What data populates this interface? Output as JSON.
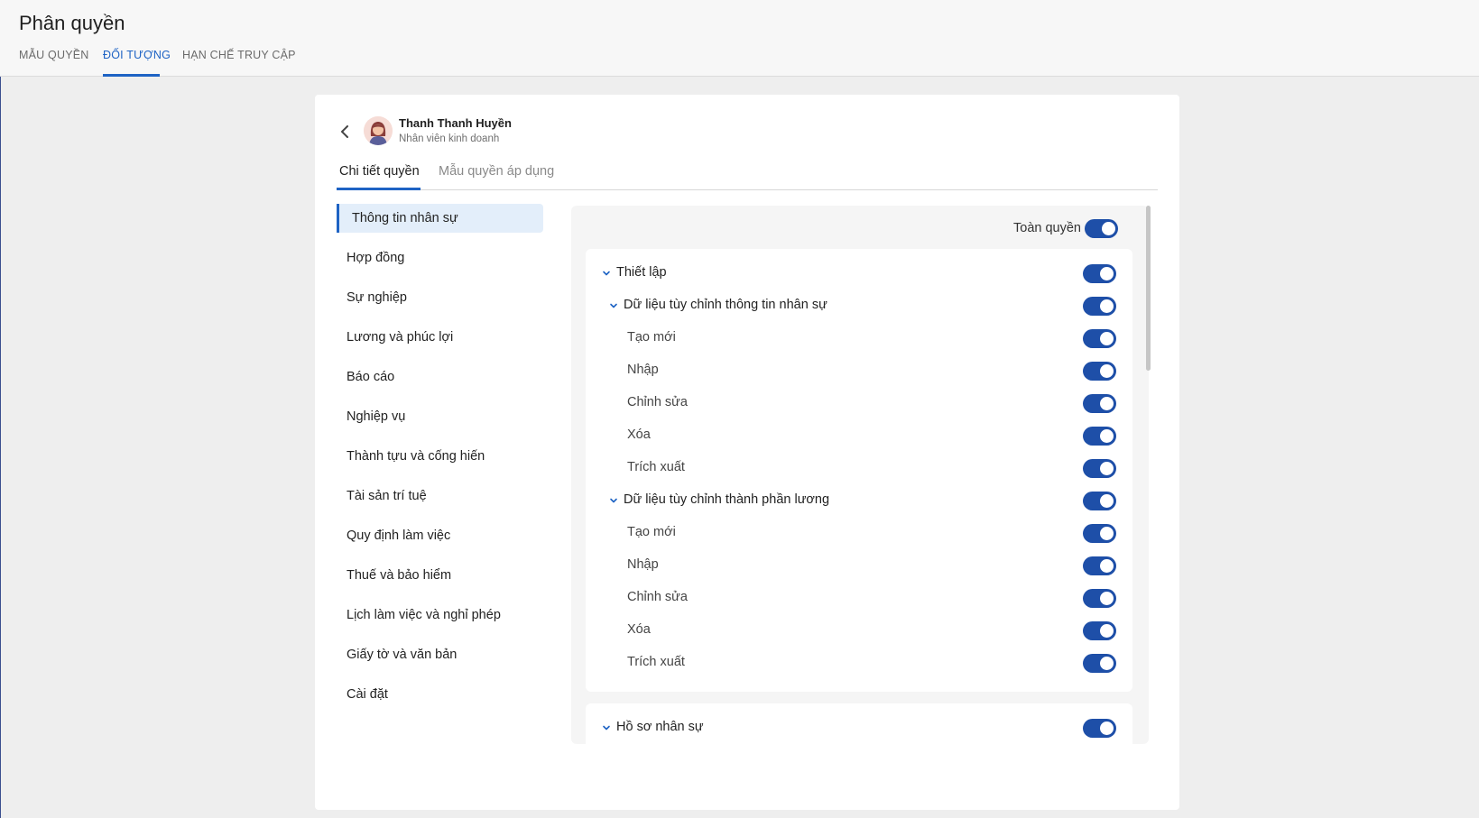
{
  "page": {
    "title": "Phân quyền",
    "tabs": [
      {
        "label": "MẪU QUYỀN"
      },
      {
        "label": "ĐỐI TƯỢNG"
      },
      {
        "label": "HẠN CHẾ TRUY CẬP"
      }
    ],
    "active_tab": "ĐỐI TƯỢNG"
  },
  "user": {
    "name": "Thanh Thanh Huyền",
    "role": "Nhân viên kinh doanh"
  },
  "detail_tabs": [
    {
      "label": "Chi tiết quyền"
    },
    {
      "label": "Mẫu quyền áp dụng"
    }
  ],
  "active_detail_tab": "Chi tiết quyền",
  "categories": [
    {
      "label": "Thông tin nhân sự"
    },
    {
      "label": "Hợp đồng"
    },
    {
      "label": "Sự nghiệp"
    },
    {
      "label": "Lương và phúc lợi"
    },
    {
      "label": "Báo cáo"
    },
    {
      "label": "Nghiệp vụ"
    },
    {
      "label": "Thành tựu và cống hiến"
    },
    {
      "label": "Tài sản trí tuệ"
    },
    {
      "label": "Quy định làm việc"
    },
    {
      "label": "Thuế và bảo hiểm"
    },
    {
      "label": "Lịch làm việc và nghỉ phép"
    },
    {
      "label": "Giấy tờ và văn bản"
    },
    {
      "label": "Cài đặt"
    }
  ],
  "active_category": "Thông tin nhân sự",
  "permissions": {
    "full_access_label": "Toàn quyền",
    "full_access_on": true,
    "setup": {
      "label": "Thiết lập",
      "on": true,
      "groups": [
        {
          "label": "Dữ liệu tùy chỉnh thông tin nhân sự",
          "on": true,
          "items": [
            {
              "label": "Tạo mới",
              "on": true
            },
            {
              "label": "Nhập",
              "on": true
            },
            {
              "label": "Chỉnh sửa",
              "on": true
            },
            {
              "label": "Xóa",
              "on": true
            },
            {
              "label": "Trích xuất",
              "on": true
            }
          ]
        },
        {
          "label": "Dữ liệu tùy chỉnh thành phần lương",
          "on": true,
          "items": [
            {
              "label": "Tạo mới",
              "on": true
            },
            {
              "label": "Nhập",
              "on": true
            },
            {
              "label": "Chỉnh sửa",
              "on": true
            },
            {
              "label": "Xóa",
              "on": true
            },
            {
              "label": "Trích xuất",
              "on": true
            }
          ]
        }
      ]
    },
    "profile": {
      "label": "Hồ sơ nhân sự",
      "on": true
    }
  },
  "colors": {
    "accent": "#1e63c4",
    "toggle_on": "#1e4fa8",
    "active_item_bg": "#e3eefa"
  }
}
